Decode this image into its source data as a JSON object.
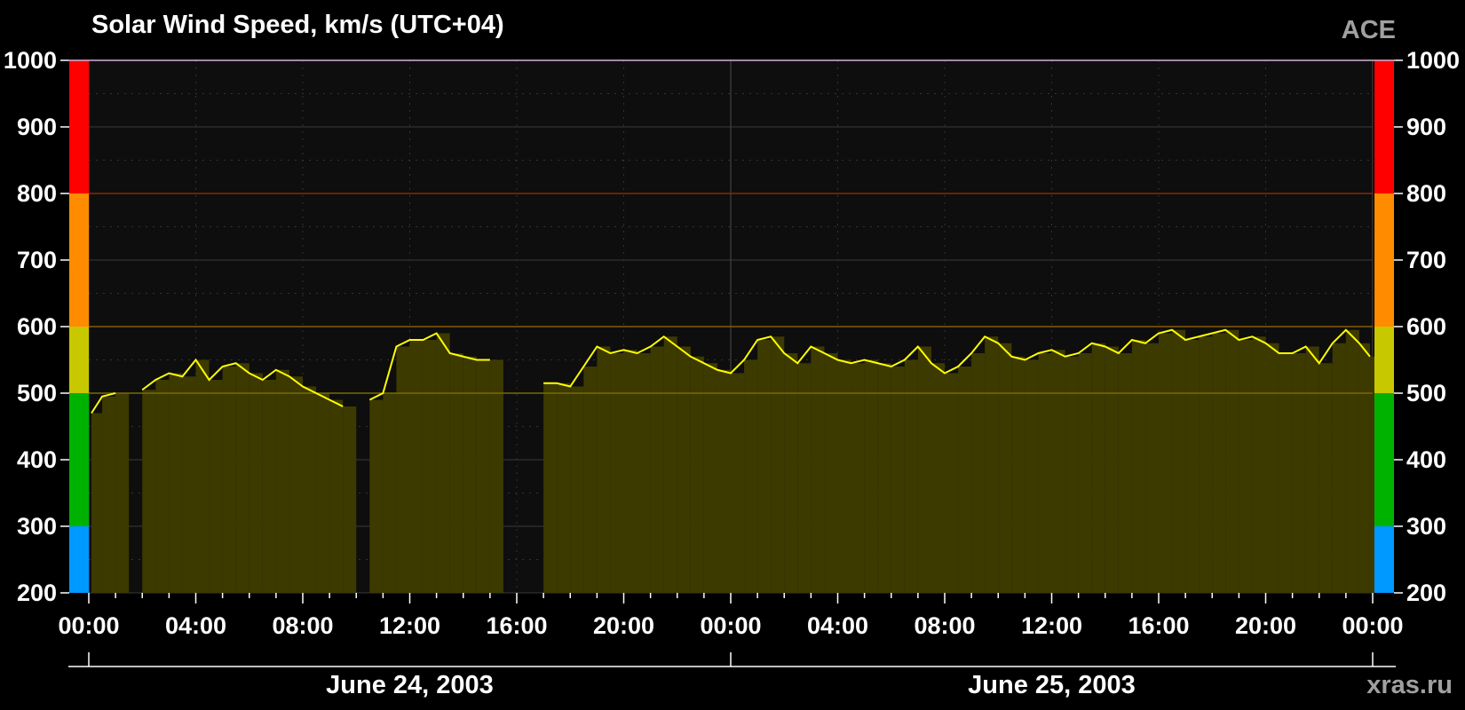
{
  "chart_data": {
    "type": "area",
    "title": "Solar Wind Speed, km/s (UTC+04)",
    "source_label": "ACE",
    "credit": "xras.ru",
    "ylim": [
      200,
      1000
    ],
    "y_ticks": [
      200,
      300,
      400,
      500,
      600,
      700,
      800,
      900,
      1000
    ],
    "y_tick_labels": [
      "200",
      "300",
      "400",
      "500",
      "600",
      "700",
      "800",
      "900",
      "1000"
    ],
    "xlim": [
      "2003-06-24 00:00",
      "2003-06-26 00:00"
    ],
    "x_tick_labels": [
      "00:00",
      "04:00",
      "08:00",
      "12:00",
      "16:00",
      "20:00",
      "00:00",
      "04:00",
      "08:00",
      "12:00",
      "16:00",
      "20:00",
      "00:00"
    ],
    "date_labels": [
      "June 24, 2003",
      "June 25, 2003"
    ],
    "grid": true,
    "thresholds": [
      500,
      600,
      800
    ],
    "level_bands": [
      {
        "from": 200,
        "to": 300,
        "color": "#0099ff"
      },
      {
        "from": 300,
        "to": 500,
        "color": "#00b200"
      },
      {
        "from": 500,
        "to": 600,
        "color": "#c8c800"
      },
      {
        "from": 600,
        "to": 800,
        "color": "#ff8c00"
      },
      {
        "from": 800,
        "to": 1000,
        "color": "#ff0000"
      }
    ],
    "colors": {
      "line": "#ffff00",
      "fill": "#3d3a00",
      "plot_background": "#0e0e0e",
      "threshold_500": "#7a6a00",
      "threshold_600": "#8a5a00",
      "threshold_800": "#8a2a00"
    },
    "series": [
      {
        "x_hours": [
          0.1,
          0.5,
          1.0,
          1.5,
          2.0,
          2.5,
          3.0,
          3.5,
          4.0,
          4.5,
          5.0,
          5.5,
          6.0,
          6.5,
          7.0,
          7.5,
          8.0,
          8.5,
          9.0,
          9.5,
          10.0,
          10.5,
          11.0,
          11.5,
          12.0,
          12.5,
          13.0,
          13.5,
          14.0,
          14.5,
          15.0,
          15.5,
          16.0,
          16.5,
          17.0,
          17.5,
          18.0,
          18.5,
          19.0,
          19.5,
          20.0,
          20.5,
          21.0,
          21.5,
          22.0,
          22.5,
          23.0,
          23.5,
          24.0,
          24.5,
          25.0,
          25.5,
          26.0,
          26.5,
          27.0,
          27.5,
          28.0,
          28.5,
          29.0,
          29.5,
          30.0,
          30.5,
          31.0,
          31.5,
          32.0,
          32.5,
          33.0,
          33.5,
          34.0,
          34.5,
          35.0,
          35.5,
          36.0,
          36.5,
          37.0,
          37.5,
          38.0,
          38.5,
          39.0,
          39.5,
          40.0,
          40.5,
          41.0,
          41.5,
          42.0,
          42.5,
          43.0,
          43.5,
          44.0,
          44.5,
          45.0,
          45.5,
          46.0,
          46.5,
          47.0,
          47.5,
          47.9
        ],
        "values": [
          470,
          495,
          500,
          null,
          505,
          520,
          530,
          525,
          550,
          520,
          540,
          545,
          530,
          520,
          535,
          525,
          510,
          500,
          490,
          480,
          null,
          490,
          500,
          570,
          580,
          580,
          590,
          560,
          555,
          550,
          550,
          null,
          null,
          null,
          515,
          515,
          510,
          540,
          570,
          560,
          565,
          560,
          570,
          585,
          570,
          555,
          545,
          535,
          530,
          550,
          580,
          585,
          560,
          545,
          570,
          560,
          550,
          545,
          550,
          545,
          540,
          550,
          570,
          545,
          530,
          540,
          560,
          585,
          575,
          555,
          550,
          560,
          565,
          555,
          560,
          575,
          570,
          560,
          580,
          575,
          590,
          595,
          580,
          585,
          590,
          595,
          580,
          585,
          575,
          560,
          560,
          570,
          545,
          575,
          595,
          575,
          555
        ]
      }
    ]
  }
}
